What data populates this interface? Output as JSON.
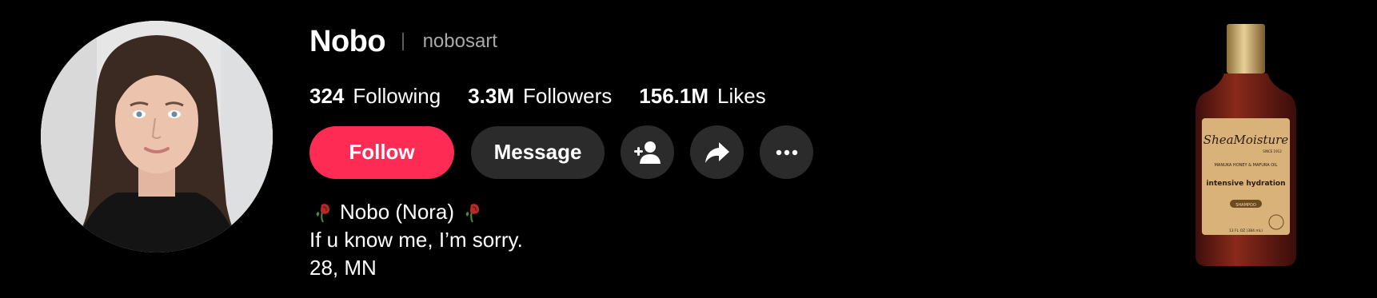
{
  "profile": {
    "display_name": "Nobo",
    "username": "nobosart",
    "avatar_icon": "profile-photo"
  },
  "stats": [
    {
      "value": "324",
      "label": "Following"
    },
    {
      "value": "3.3M",
      "label": "Followers"
    },
    {
      "value": "156.1M",
      "label": "Likes"
    }
  ],
  "actions": {
    "follow_label": "Follow",
    "message_label": "Message",
    "add_friend_icon": "add-user-icon",
    "share_icon": "share-arrow-icon",
    "more_icon": "more-dots-icon"
  },
  "bio": {
    "name_line": "Nobo (Nora)",
    "line2": "If u know me, I’m sorry.",
    "line3": "28, MN",
    "emoji": "wilted-rose"
  },
  "ad": {
    "brand": "SheaMoisture",
    "since": "SINCE 1912",
    "subline": "MANUKA HONEY & MAFURA OIL",
    "product": "intensive hydration",
    "type": "SHAMPOO",
    "size": "13 FL OZ (384 mL)"
  },
  "colors": {
    "background": "#000000",
    "follow_button": "#fe2c55",
    "secondary_button": "#2b2b2b",
    "muted_text": "#a9a9aa"
  }
}
